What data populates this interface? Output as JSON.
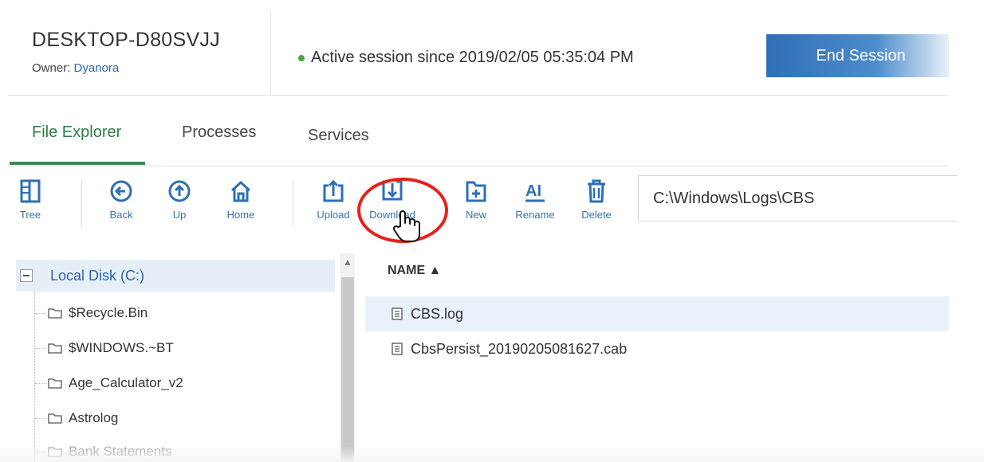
{
  "device": {
    "name": "DESKTOP-D80SVJJ",
    "owner_label": "Owner: ",
    "owner_name": "Dyanora"
  },
  "session": {
    "status_text": "Active session since 2019/02/05 05:35:04 PM",
    "status_color": "#49a84a",
    "end_button_label": "End Session"
  },
  "tabs": [
    {
      "label": "File Explorer",
      "active": true
    },
    {
      "label": "Processes",
      "active": false
    },
    {
      "label": "Services",
      "active": false
    }
  ],
  "toolbar": {
    "tree": "Tree",
    "back": "Back",
    "up": "Up",
    "home": "Home",
    "upload": "Upload",
    "download": "Download",
    "new": "New",
    "rename": "Rename",
    "delete": "Delete",
    "path_value": "C:\\Windows\\Logs\\CBS"
  },
  "tree": {
    "root": "Local Disk (C:)",
    "items": [
      "$Recycle.Bin",
      "$WINDOWS.~BT",
      "Age_Calculator_v2",
      "Astrolog",
      "Bank Statements"
    ]
  },
  "files": {
    "column_header": "NAME ▲",
    "rows": [
      {
        "name": "CBS.log",
        "selected": true
      },
      {
        "name": "CbsPersist_20190205081627.cab",
        "selected": false
      }
    ]
  },
  "colors": {
    "accent_blue": "#2e6fb6",
    "tab_active": "#2f7d45",
    "highlight_ring": "#e3231b"
  }
}
